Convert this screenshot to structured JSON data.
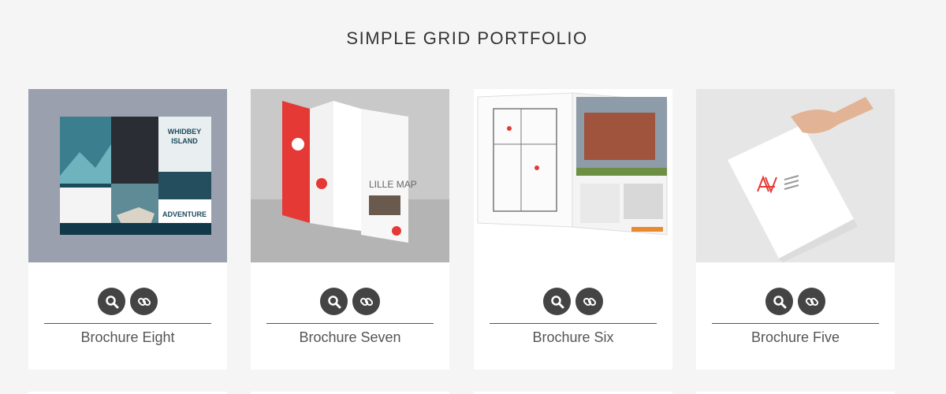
{
  "page": {
    "title": "SIMPLE GRID PORTFOLIO"
  },
  "cards": [
    {
      "name": "Brochure Eight",
      "zoom_icon": "magnifier-icon",
      "link_icon": "link-icon",
      "thumb_text": {
        "line1": "WHIDBEY",
        "line2": "ISLAND",
        "cta": "ADVENTURE"
      }
    },
    {
      "name": "Brochure Seven",
      "zoom_icon": "magnifier-icon",
      "link_icon": "link-icon",
      "thumb_text": {
        "map": "LILLE MAP"
      }
    },
    {
      "name": "Brochure Six",
      "zoom_icon": "magnifier-icon",
      "link_icon": "link-icon"
    },
    {
      "name": "Brochure Five",
      "zoom_icon": "magnifier-icon",
      "link_icon": "link-icon"
    }
  ],
  "colors": {
    "background": "#f5f5f5",
    "card": "#ffffff",
    "button": "#444444",
    "accent_red": "#e53935"
  }
}
